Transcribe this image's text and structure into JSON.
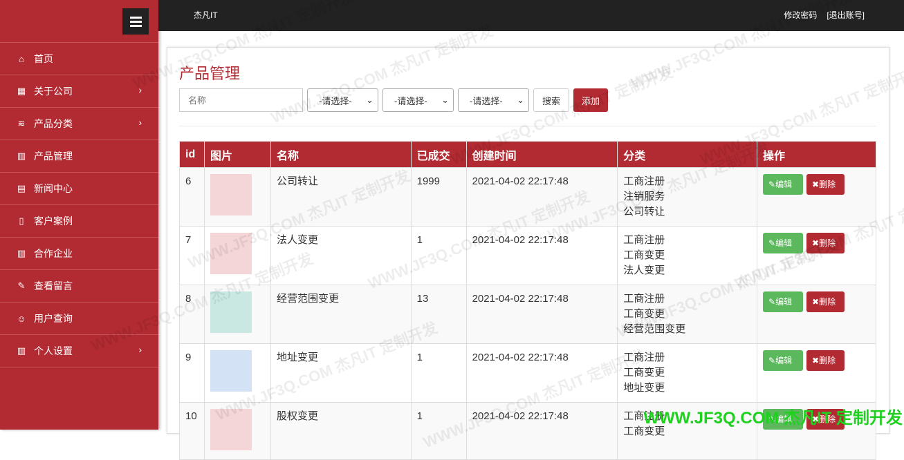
{
  "sidebar": {
    "items": [
      {
        "label": "首页",
        "icon": "home-icon",
        "glyph": "⌂",
        "chevron": false
      },
      {
        "label": "关于公司",
        "icon": "table-icon",
        "glyph": "▦",
        "chevron": true
      },
      {
        "label": "产品分类",
        "icon": "layers-icon",
        "glyph": "≋",
        "chevron": true
      },
      {
        "label": "产品管理",
        "icon": "bar-chart-icon",
        "glyph": "▥",
        "chevron": false
      },
      {
        "label": "新闻中心",
        "icon": "file-icon",
        "glyph": "▤",
        "chevron": false
      },
      {
        "label": "客户案例",
        "icon": "book-icon",
        "glyph": "▯",
        "chevron": false
      },
      {
        "label": "合作企业",
        "icon": "bar-chart-icon",
        "glyph": "▥",
        "chevron": false
      },
      {
        "label": "查看留言",
        "icon": "pencil-icon",
        "glyph": "✎",
        "chevron": false
      },
      {
        "label": "用户查询",
        "icon": "user-icon",
        "glyph": "☺",
        "chevron": false
      },
      {
        "label": "个人设置",
        "icon": "bar-chart-icon",
        "glyph": "▥",
        "chevron": true
      }
    ]
  },
  "topbar": {
    "brand": "杰凡IT",
    "change_password": "修改密码",
    "logout": "[退出账号]"
  },
  "main": {
    "title": "产品管理",
    "search_placeholder": "名称",
    "selects": [
      "-请选择-",
      "-请选择-",
      "-请选择-"
    ],
    "search_label": "搜索",
    "add_label": "添加"
  },
  "table": {
    "headers": [
      "id",
      "图片",
      "名称",
      "已成交",
      "创建时间",
      "分类",
      "操作"
    ],
    "edit_label": "编辑",
    "delete_label": "删除",
    "rows": [
      {
        "id": "6",
        "name": "公司转让",
        "sold": "1999",
        "created": "2021-04-02 22:17:48",
        "categories": [
          "工商注册",
          "注销服务",
          "公司转让"
        ],
        "thumb_color": "#f4d6d8"
      },
      {
        "id": "7",
        "name": "法人变更",
        "sold": "1",
        "created": "2021-04-02 22:17:48",
        "categories": [
          "工商注册",
          "工商变更",
          "法人变更"
        ],
        "thumb_color": "#f4d6d8"
      },
      {
        "id": "8",
        "name": "经营范围变更",
        "sold": "13",
        "created": "2021-04-02 22:17:48",
        "categories": [
          "工商注册",
          "工商变更",
          "经营范围变更"
        ],
        "thumb_color": "#c9e8e2"
      },
      {
        "id": "9",
        "name": "地址变更",
        "sold": "1",
        "created": "2021-04-02 22:17:48",
        "categories": [
          "工商注册",
          "工商变更",
          "地址变更"
        ],
        "thumb_color": "#d3e3f5"
      },
      {
        "id": "10",
        "name": "股权变更",
        "sold": "1",
        "created": "2021-04-02 22:17:48",
        "categories": [
          "工商注册",
          "工商变更"
        ],
        "thumb_color": "#f4d6d8"
      }
    ]
  },
  "watermark": "WWW.JF3Q.COM 杰凡IT 定制开发"
}
